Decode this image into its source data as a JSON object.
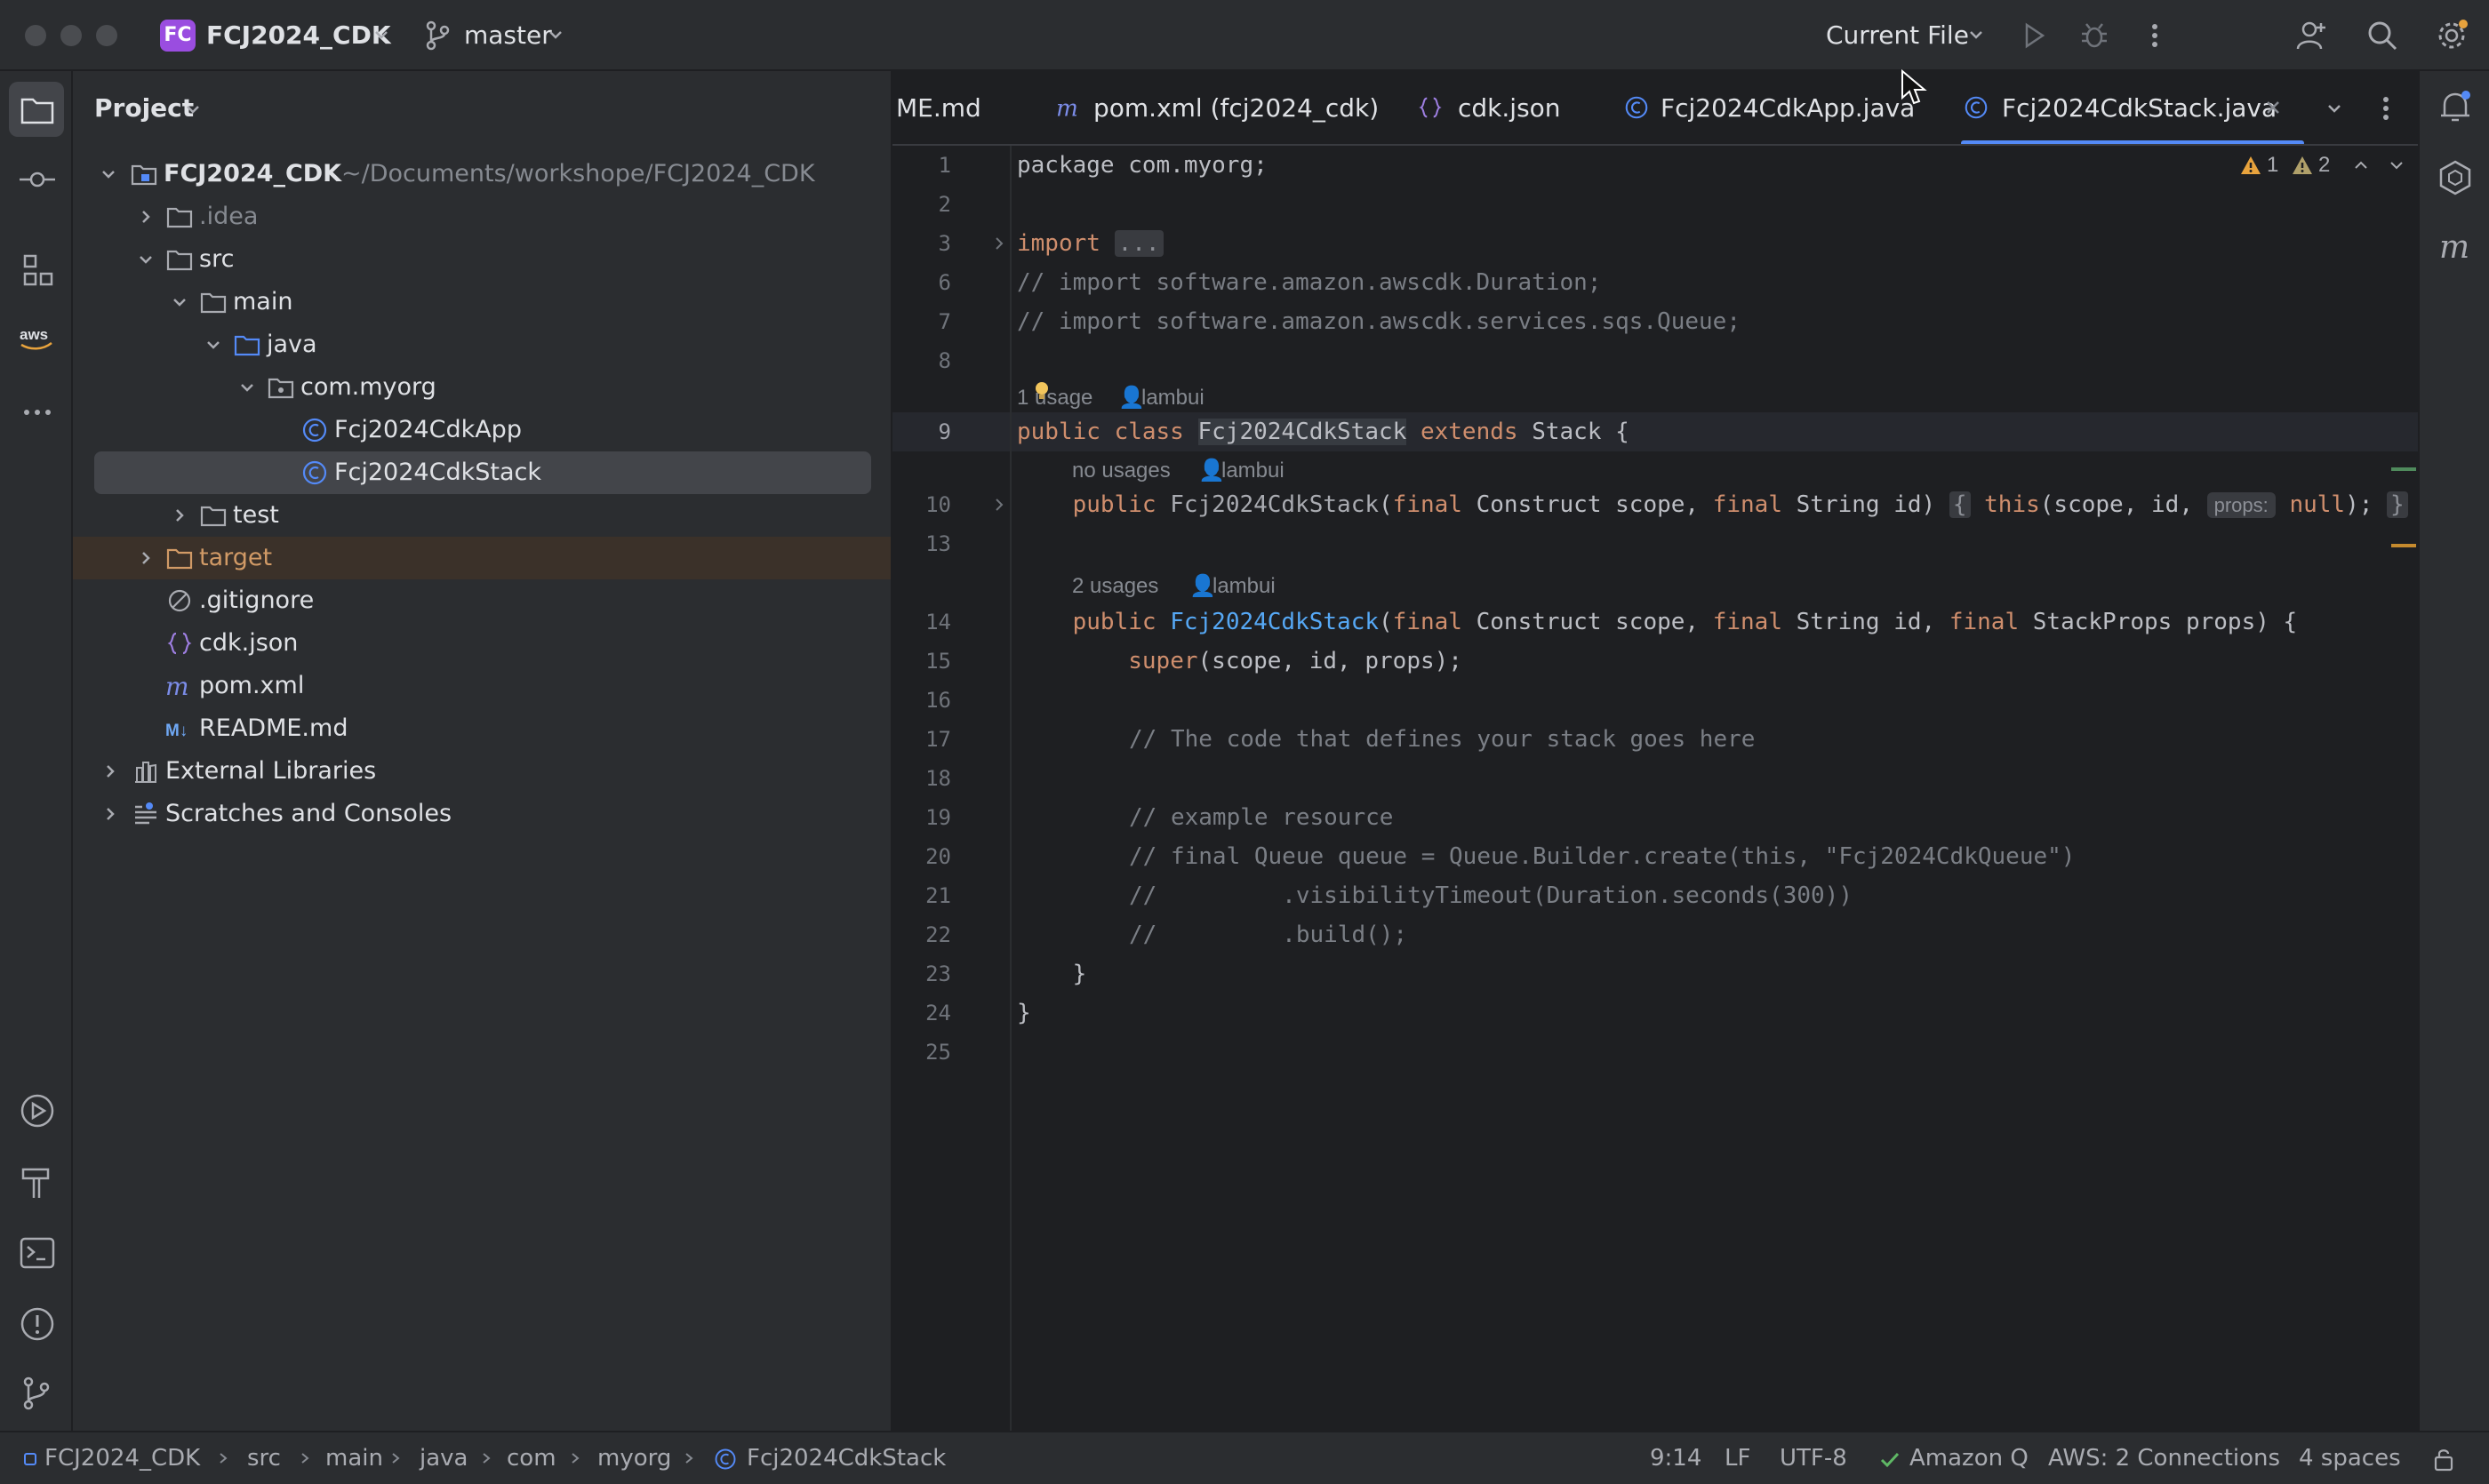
{
  "titlebar": {
    "project_badge": "FC",
    "project_name": "FCJ2024_CDK",
    "branch": "master",
    "run_config": "Current File"
  },
  "project_panel": {
    "title": "Project",
    "tree": [
      {
        "label": "FCJ2024_CDK",
        "sub": "~/Documents/workshope/FCJ2024_CDK",
        "icon": "module-folder-icon",
        "expanded": true
      },
      {
        "label": ".idea",
        "icon": "folder-icon",
        "expanded": false
      },
      {
        "label": "src",
        "icon": "folder-icon",
        "expanded": true
      },
      {
        "label": "main",
        "icon": "folder-icon",
        "expanded": true
      },
      {
        "label": "java",
        "icon": "source-folder-icon",
        "expanded": true
      },
      {
        "label": "com.myorg",
        "icon": "package-icon",
        "expanded": true
      },
      {
        "label": "Fcj2024CdkApp",
        "icon": "java-class-icon"
      },
      {
        "label": "Fcj2024CdkStack",
        "icon": "java-class-icon",
        "selected": true
      },
      {
        "label": "test",
        "icon": "folder-icon",
        "expanded": false
      },
      {
        "label": "target",
        "icon": "excluded-folder-icon",
        "expanded": false
      },
      {
        "label": ".gitignore",
        "icon": "gitignore-icon"
      },
      {
        "label": "cdk.json",
        "icon": "json-icon"
      },
      {
        "label": "pom.xml",
        "icon": "maven-icon"
      },
      {
        "label": "README.md",
        "icon": "markdown-icon"
      },
      {
        "label": "External Libraries",
        "icon": "library-icon",
        "expanded": false
      },
      {
        "label": "Scratches and Consoles",
        "icon": "scratches-icon",
        "expanded": false
      }
    ]
  },
  "tabs": [
    {
      "label": "ME.md",
      "icon": "markdown-icon"
    },
    {
      "label": "pom.xml (fcj2024_cdk)",
      "icon": "maven-icon"
    },
    {
      "label": "cdk.json",
      "icon": "json-icon"
    },
    {
      "label": "Fcj2024CdkApp.java",
      "icon": "java-class-icon"
    },
    {
      "label": "Fcj2024CdkStack.java",
      "icon": "java-class-icon",
      "active": true
    }
  ],
  "inspections": {
    "warnings": "1",
    "weak_warnings": "2"
  },
  "editor": {
    "line_numbers": [
      "1",
      "2",
      "3",
      "6",
      "7",
      "8",
      "9",
      "10",
      "13",
      "14",
      "15",
      "16",
      "17",
      "18",
      "19",
      "20",
      "21",
      "22",
      "23",
      "24",
      "25"
    ],
    "hints": {
      "class_usages": "1 usage",
      "class_author": "lambui",
      "ctor1_usages": "no usages",
      "ctor1_author": "lambui",
      "ctor2_usages": "2 usages",
      "ctor2_author": "lambui"
    },
    "inlay_props": "props:",
    "lines": {
      "l1": "package com.myorg;",
      "l3_kw": "import",
      "l3_fold": "...",
      "l6": "// import software.amazon.awscdk.Duration;",
      "l7": "// import software.amazon.awscdk.services.sqs.Queue;",
      "l15_super": "super",
      "l15_rest": "(scope, id, props);",
      "l17": "// The code that defines your stack goes here",
      "l19": "// example resource",
      "l20": "// final Queue queue = Queue.Builder.create(this, \"Fcj2024CdkQueue\")",
      "l21": "//         .visibilityTimeout(Duration.seconds(300))",
      "l22": "//         .build();",
      "l23": "    }",
      "l24": "}"
    }
  },
  "statusbar": {
    "breadcrumbs": [
      "FCJ2024_CDK",
      "src",
      "main",
      "java",
      "com",
      "myorg",
      "Fcj2024CdkStack"
    ],
    "position": "9:14",
    "line_sep": "LF",
    "encoding": "UTF-8",
    "amazon_q": "Amazon Q",
    "aws": "AWS: 2 Connections",
    "indent": "4 spaces"
  },
  "colors": {
    "accent": "#548af7",
    "keyword": "#cf8e6d",
    "comment": "#7a7e85",
    "function": "#56a8f5",
    "project_badge": "#9a4de0",
    "excluded": "#d19a66"
  }
}
